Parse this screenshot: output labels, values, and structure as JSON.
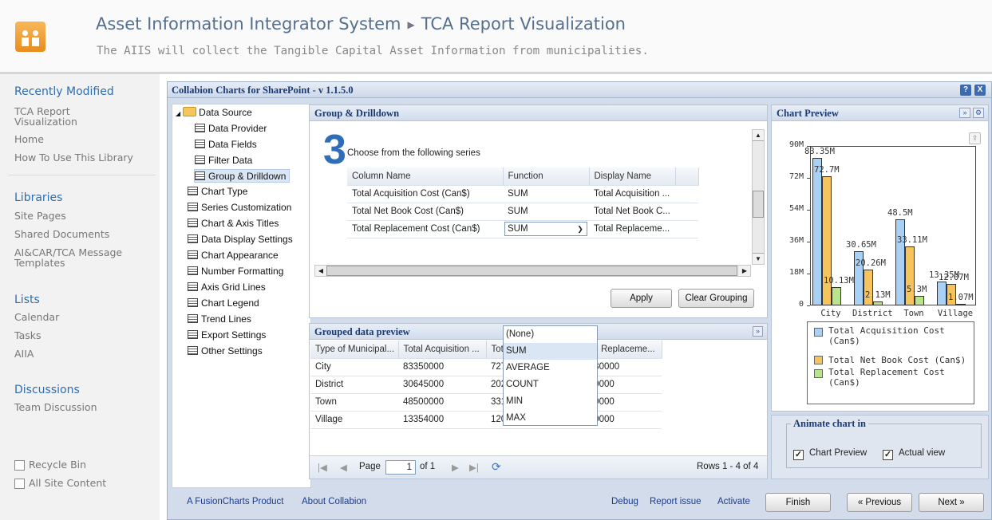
{
  "header": {
    "site_title": "Asset Information Integrator System",
    "page_title": "TCA Report Visualization",
    "subtitle": "The AIIS will collect the Tangible Capital Asset Information from municipalities."
  },
  "nav": {
    "recently_modified_heading": "Recently Modified",
    "recent_items": [
      "TCA Report",
      "Visualization",
      "Home",
      "How To Use This Library"
    ],
    "libraries_heading": "Libraries",
    "library_items": [
      "Site Pages",
      "Shared Documents",
      "AI&CAR/TCA Message",
      "Templates"
    ],
    "lists_heading": "Lists",
    "list_items": [
      "Calendar",
      "Tasks",
      "AIIA"
    ],
    "discussions_heading": "Discussions",
    "discussion_items": [
      "Team Discussion"
    ],
    "recycle_bin": "Recycle Bin",
    "all_site_content": "All Site Content"
  },
  "frame": {
    "title": "Collabion Charts for SharePoint - v 1.1.5.0",
    "help_btn": "?",
    "close_btn": "X"
  },
  "tree": {
    "root": "Data Source",
    "children": [
      "Data Provider",
      "Data Fields",
      "Filter Data",
      "Group & Drilldown"
    ],
    "items": [
      "Chart Type",
      "Series Customization",
      "Chart & Axis Titles",
      "Data Display Settings",
      "Chart Appearance",
      "Number Formatting",
      "Axis Grid Lines",
      "Chart Legend",
      "Trend Lines",
      "Export Settings",
      "Other Settings"
    ]
  },
  "group_drilldown": {
    "heading": "Group & Drilldown",
    "step_number": "3",
    "instruction": "Choose from the following series",
    "columns": [
      "Column Name",
      "Function",
      "Display Name"
    ],
    "rows": [
      [
        "Total Acquisition Cost (Can$)",
        "SUM",
        "Total Acquisition ..."
      ],
      [
        "Total Net Book Cost (Can$)",
        "SUM",
        "Total Net Book C..."
      ],
      [
        "Total Replacement Cost (Can$)",
        "SUM",
        "Total Replaceme..."
      ]
    ],
    "dropdown_options": [
      "(None)",
      "SUM",
      "AVERAGE",
      "COUNT",
      "MIN",
      "MAX"
    ],
    "apply_btn": "Apply",
    "clear_btn": "Clear Grouping"
  },
  "preview": {
    "heading": "Grouped data preview",
    "columns": [
      "Type of Municipal...",
      "Total Acquisition ...",
      "Total Net Book C...",
      "Total Replaceme..."
    ],
    "rows": [
      [
        "City",
        "83350000",
        "72700000",
        "10130000"
      ],
      [
        "District",
        "30645000",
        "20255000",
        "2130000"
      ],
      [
        "Town",
        "48500000",
        "33110000",
        "5300000"
      ],
      [
        "Village",
        "13354000",
        "12070000",
        "1070000"
      ]
    ],
    "page_label": "Page",
    "page_value": "1",
    "of_label": "of 1",
    "rows_label": "Rows 1 - 4 of 4"
  },
  "chart_preview": {
    "heading": "Chart Preview",
    "animate_heading": "Animate chart in",
    "animate_options": [
      "Chart Preview",
      "Actual view"
    ]
  },
  "chart_data": {
    "type": "bar",
    "categories": [
      "City",
      "District",
      "Town",
      "Village"
    ],
    "y_ticks": [
      "0",
      "18M",
      "36M",
      "54M",
      "72M",
      "90M"
    ],
    "ylim": [
      0,
      90
    ],
    "series": [
      {
        "name": "Total Acquisition Cost (Can$)",
        "values": [
          83.35,
          30.65,
          48.5,
          13.35
        ],
        "labels": [
          "83.35M",
          "30.65M",
          "48.5M",
          "13.35M"
        ],
        "color": "#a9d0f5"
      },
      {
        "name": "Total Net Book Cost (Can$)",
        "values": [
          72.7,
          20.26,
          33.11,
          12.07
        ],
        "labels": [
          "72.7M",
          "20.26M",
          "33.11M",
          "12.07M"
        ],
        "color": "#f7c45c"
      },
      {
        "name": "Total Replacement Cost (Can$)",
        "values": [
          10.13,
          2.13,
          5.3,
          1.07
        ],
        "labels": [
          "10.13M",
          "2.13M",
          "5.3M",
          "1.07M"
        ],
        "color": "#b9e58a"
      }
    ]
  },
  "footer": {
    "fusion_link": "A FusionCharts Product",
    "about_link": "About Collabion",
    "debug_link": "Debug",
    "report_link": "Report issue",
    "activate_link": "Activate",
    "finish_btn": "Finish",
    "prev_btn": "« Previous",
    "next_btn": "Next »"
  }
}
